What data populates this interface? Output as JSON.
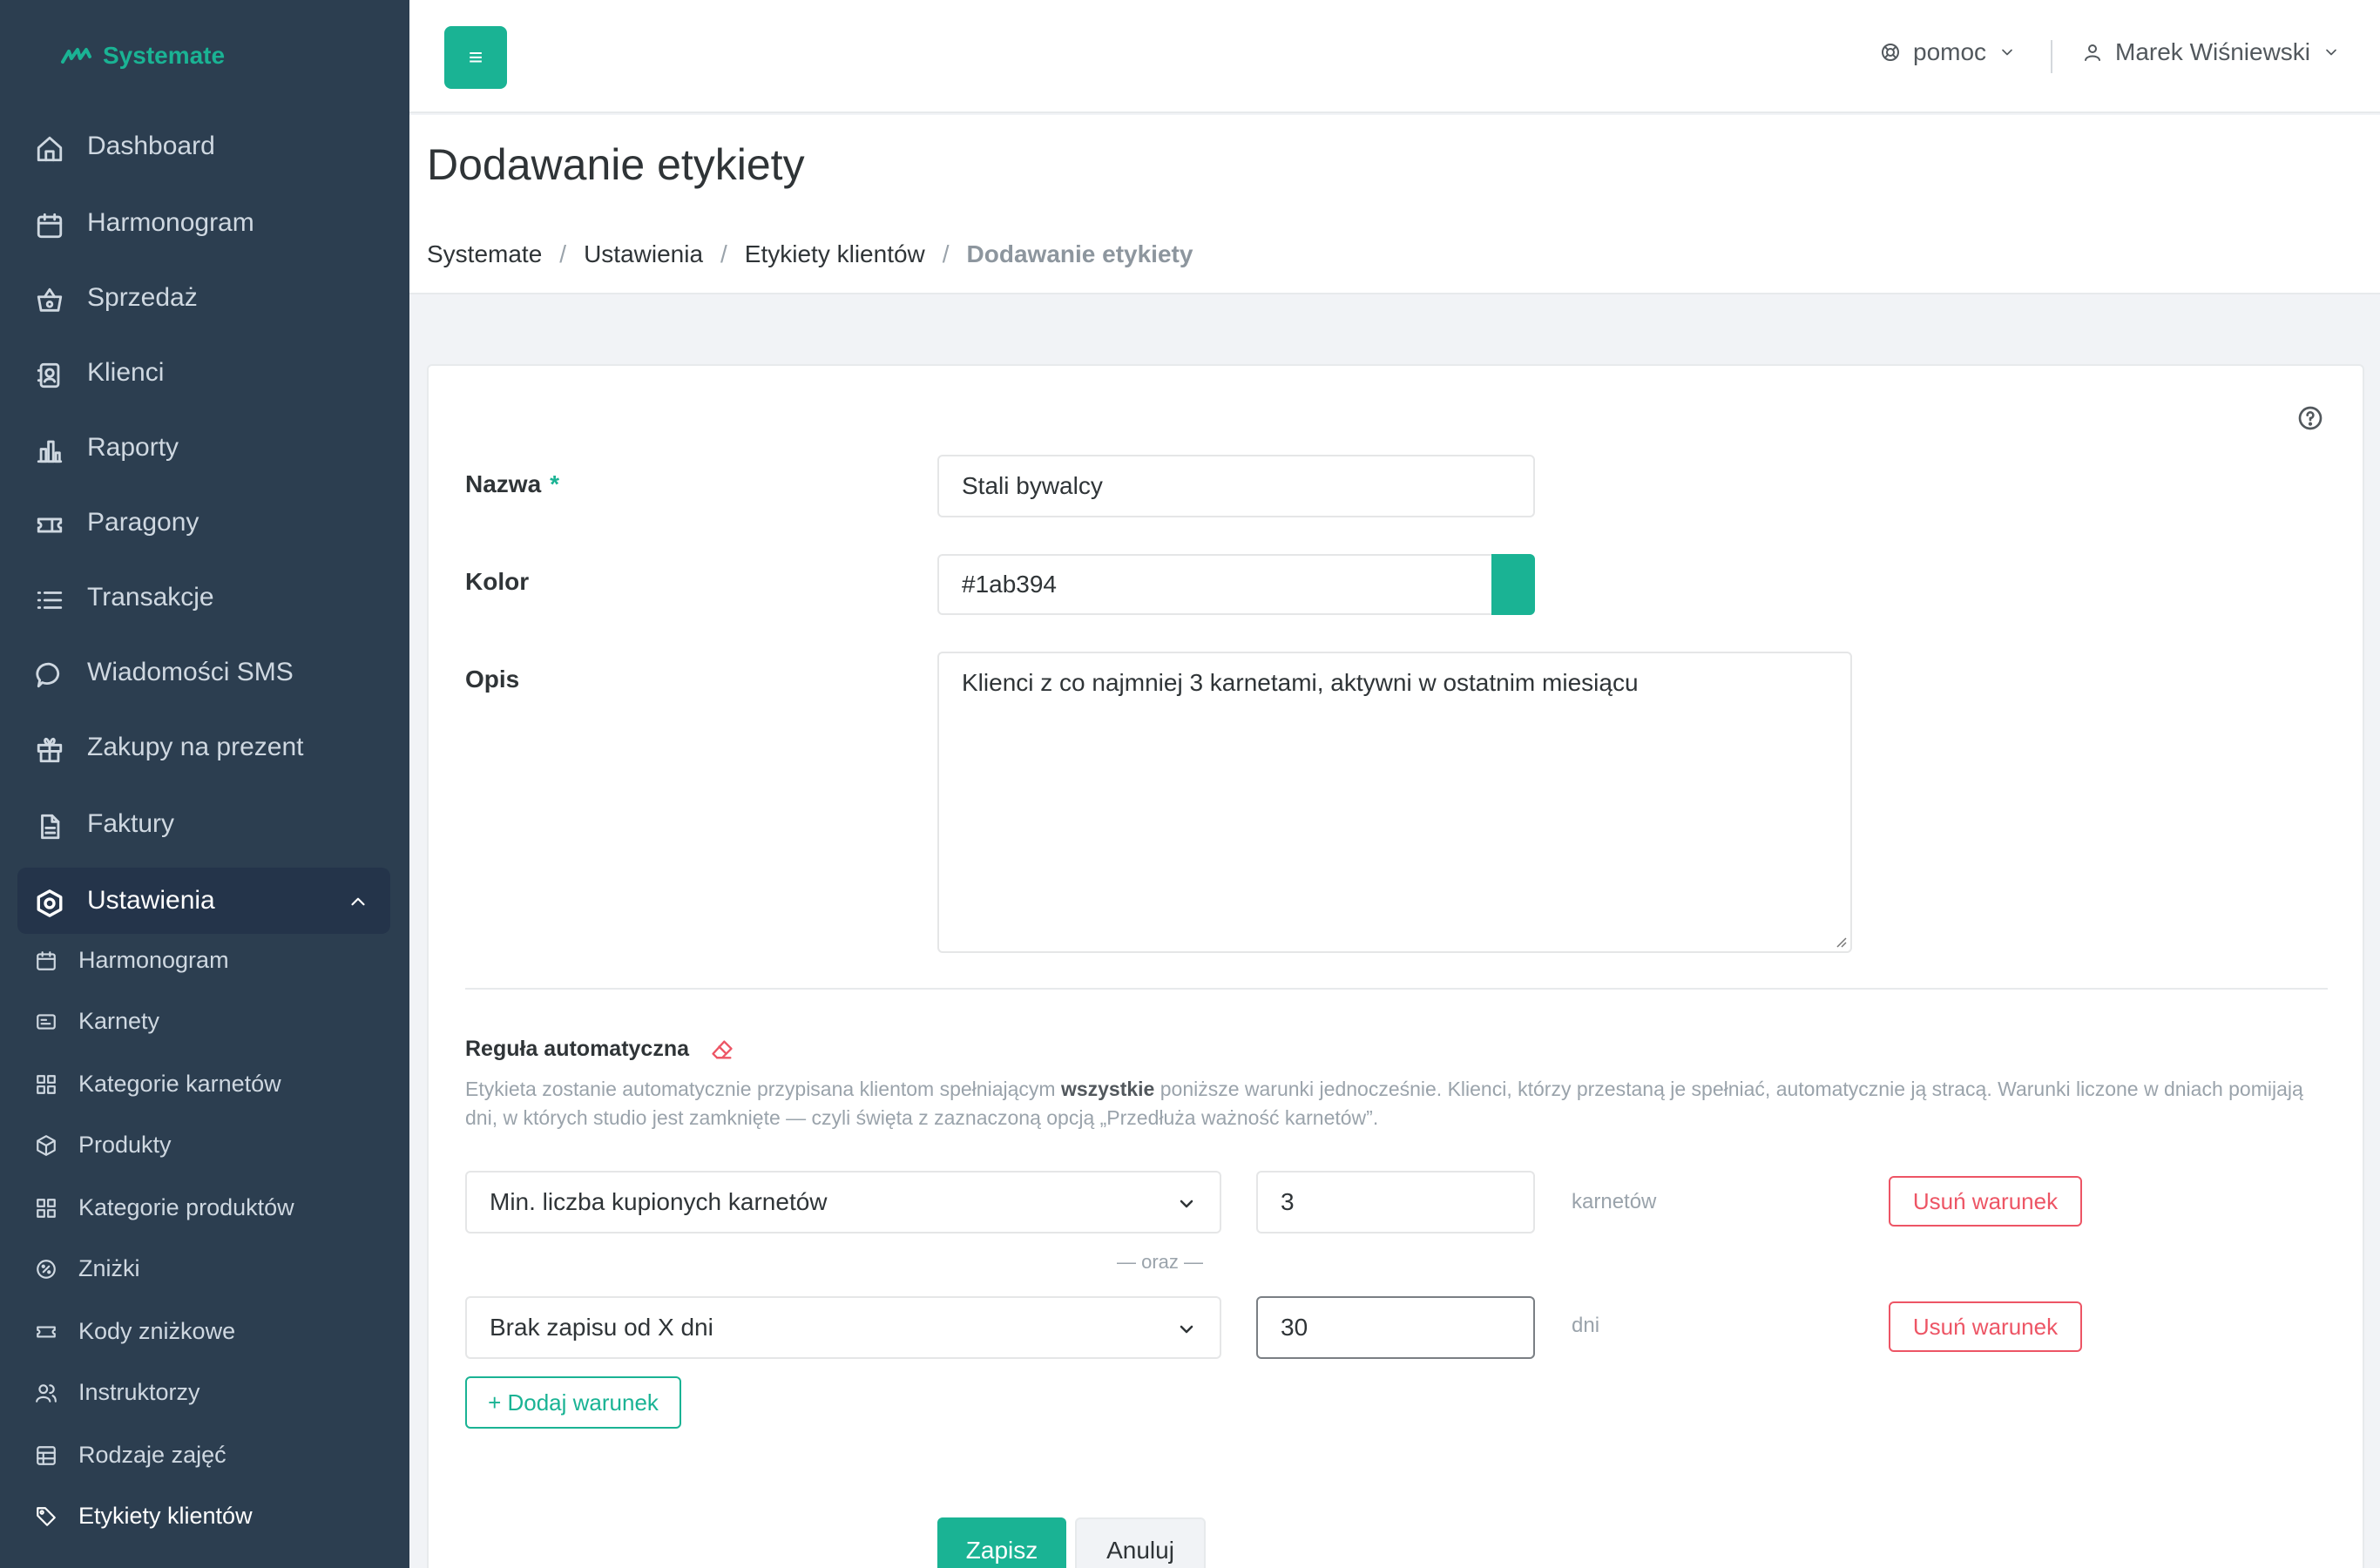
{
  "app": {
    "logo_text": "Systemate",
    "accent_color": "#1ab394",
    "sidebar_bg": "#2c3e50"
  },
  "sidebar": {
    "items": [
      {
        "label": "Dashboard",
        "icon": "home-icon"
      },
      {
        "label": "Harmonogram",
        "icon": "calendar-icon"
      },
      {
        "label": "Sprzedaż",
        "icon": "basket-icon"
      },
      {
        "label": "Klienci",
        "icon": "contacts-icon"
      },
      {
        "label": "Raporty",
        "icon": "bar-chart-icon"
      },
      {
        "label": "Paragony",
        "icon": "ticket-icon"
      },
      {
        "label": "Transakcje",
        "icon": "list-icon"
      },
      {
        "label": "Wiadomości SMS",
        "icon": "chat-icon"
      },
      {
        "label": "Zakupy na prezent",
        "icon": "gift-icon"
      },
      {
        "label": "Faktury",
        "icon": "document-icon"
      },
      {
        "label": "Ustawienia",
        "icon": "settings-icon"
      }
    ],
    "subitems": [
      {
        "label": "Harmonogram",
        "icon": "calendar-edit-icon"
      },
      {
        "label": "Karnety",
        "icon": "card-icon"
      },
      {
        "label": "Kategorie karnetów",
        "icon": "grid-icon"
      },
      {
        "label": "Produkty",
        "icon": "box-icon"
      },
      {
        "label": "Kategorie produktów",
        "icon": "grid-icon"
      },
      {
        "label": "Zniżki",
        "icon": "percent-icon"
      },
      {
        "label": "Kody zniżkowe",
        "icon": "coupon-icon"
      },
      {
        "label": "Instruktorzy",
        "icon": "users-icon"
      },
      {
        "label": "Rodzaje zajęć",
        "icon": "table-icon"
      },
      {
        "label": "Etykiety klientów",
        "icon": "tag-icon"
      }
    ]
  },
  "topbar": {
    "menu_label": "≡",
    "help_label": "pomoc",
    "user_name": "Marek Wiśniewski"
  },
  "header": {
    "title": "Dodawanie etykiety",
    "breadcrumb": [
      "Systemate",
      "Ustawienia",
      "Etykiety klientów",
      "Dodawanie etykiety"
    ],
    "breadcrumb_sep": "/"
  },
  "form": {
    "name_label": "Nazwa",
    "required_mark": "*",
    "name_value": "Stali bywalcy",
    "color_label": "Kolor",
    "color_value": "#1ab394",
    "description_label": "Opis",
    "description_value": "Klienci z co najmniej 3 karnetami, aktywni w ostatnim miesiącu",
    "rule_title": "Reguła automatyczna",
    "rule_desc_before": "Etykieta zostanie automatycznie przypisana klientom spełniającym ",
    "rule_desc_bold": "wszystkie",
    "rule_desc_after": " poniższe warunki jednocześnie. Klienci, którzy przestaną je spełniać, automatycznie ją stracą. Warunki liczone w dniach pomijają dni, w których studio jest zamknięte — czyli święta z zaznaczoną opcją „Przedłuża ważność karnetów”.",
    "conditions": [
      {
        "type": "Min. liczba kupionych karnetów",
        "value": "3",
        "unit": "karnetów",
        "remove_label": "Usuń warunek"
      },
      {
        "type": "Brak zapisu od X dni",
        "value": "30",
        "unit": "dni",
        "remove_label": "Usuń warunek"
      }
    ],
    "and_separator": "— oraz —",
    "add_condition_label": "+ Dodaj warunek",
    "save_label": "Zapisz",
    "cancel_label": "Anuluj"
  }
}
